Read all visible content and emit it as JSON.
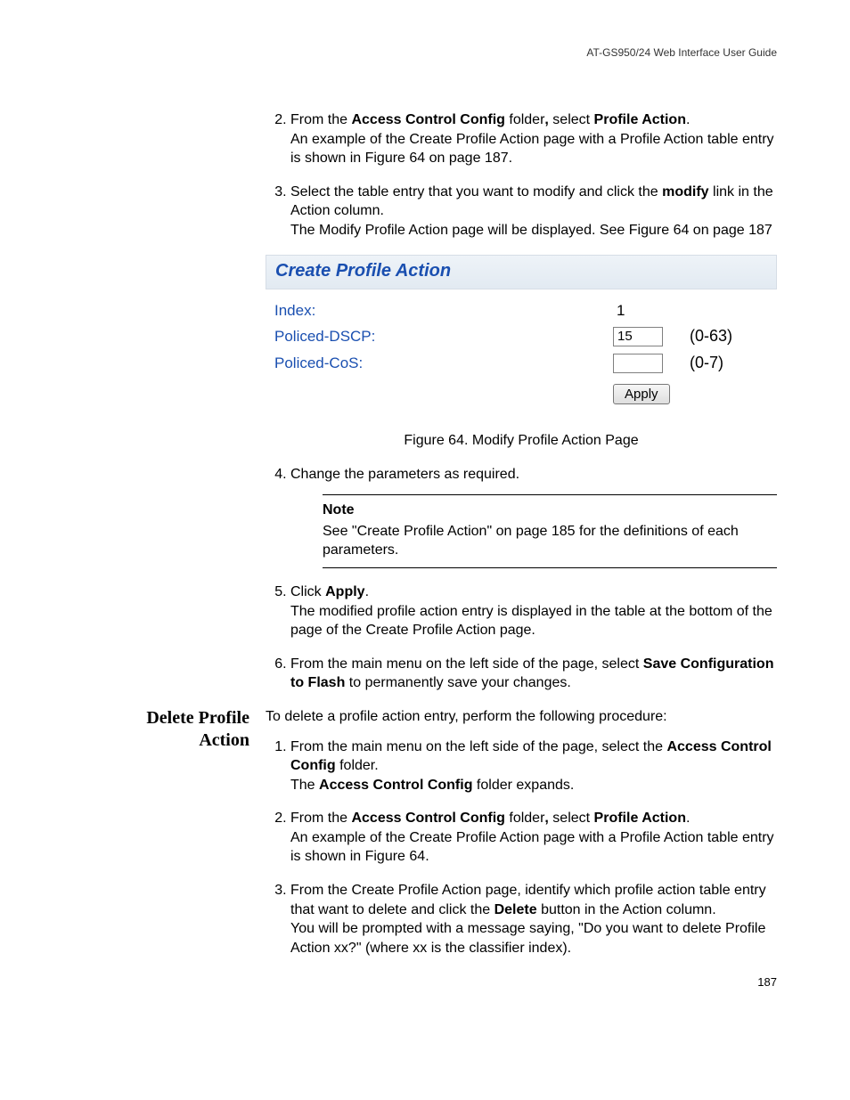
{
  "header": {
    "right": "AT-GS950/24  Web Interface User Guide"
  },
  "steps_a": {
    "start": 2,
    "s2": {
      "pre": "From the ",
      "b1": "Access Control Config",
      "mid1": " folder",
      "comma": ",",
      "mid2": " select ",
      "b2": "Profile Action",
      "post": ".",
      "line2": "An example of the Create Profile Action page with a Profile Action table entry is shown in Figure 64 on page 187."
    },
    "s3": {
      "pre": "Select the table entry that you want to modify and click the ",
      "b1": "modify",
      "post": " link in the Action column.",
      "line2": "The Modify Profile Action page will be displayed. See Figure 64 on page 187"
    }
  },
  "figure": {
    "panel_title": "Create Profile Action",
    "rows": {
      "index": {
        "label": "Index:",
        "value": "1"
      },
      "dscp": {
        "label": "Policed-DSCP:",
        "input": "15",
        "range": "(0-63)"
      },
      "cos": {
        "label": "Policed-CoS:",
        "input": "",
        "range": "(0-7)"
      }
    },
    "apply": "Apply",
    "caption": "Figure 64. Modify Profile Action Page"
  },
  "steps_b": {
    "start": 4,
    "s4": {
      "text": "Change the parameters as required."
    },
    "note": {
      "title": "Note",
      "body": "See \"Create Profile Action\" on page 185 for the definitions of each parameters."
    },
    "s5": {
      "pre": "Click ",
      "b1": "Apply",
      "post": ".",
      "line2": "The modified profile action entry is displayed in the table at the bottom of the page of the Create Profile Action page."
    },
    "s6": {
      "pre": "From the main menu on the left side of the page, select ",
      "b1": "Save Configuration to Flash",
      "post": " to permanently save your changes."
    }
  },
  "section2": {
    "heading_l1": "Delete Profile",
    "heading_l2": "Action",
    "intro": "To delete a profile action entry, perform the following procedure:",
    "s1": {
      "pre": "From the main menu on the left side of the page, select the ",
      "b1": "Access Control Config",
      "post": " folder.",
      "line2a": "The ",
      "line2b": "Access Control Config",
      "line2c": " folder expands."
    },
    "s2": {
      "pre": "From the ",
      "b1": "Access Control Config",
      "mid1": " folder",
      "comma": ",",
      "mid2": " select ",
      "b2": "Profile Action",
      "post": ".",
      "line2": "An example of the Create Profile Action page with a Profile Action table entry is shown in Figure 64."
    },
    "s3": {
      "pre": "From the Create Profile Action page, identify which profile action table entry that want to delete and click the ",
      "b1": "Delete",
      "post": " button in the Action column.",
      "line2": "You will be prompted with a message saying, \"Do you want to delete Profile Action xx?\" (where xx is the classifier index)."
    }
  },
  "page_number": "187"
}
